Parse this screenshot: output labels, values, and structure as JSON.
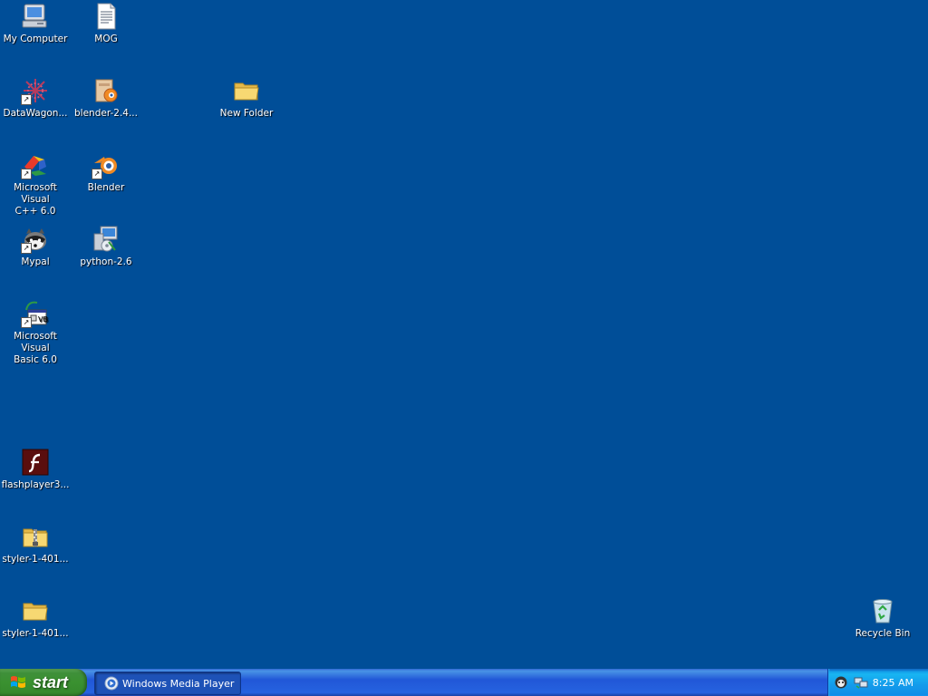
{
  "desktop": {
    "background_color": "#004E98",
    "icons": [
      {
        "label": "My Computer",
        "icon": "my-computer-icon"
      },
      {
        "label": "MOG",
        "icon": "text-document-icon"
      },
      {
        "label": "DataWagon...",
        "icon": "datawagon-icon"
      },
      {
        "label": "blender-2.4...",
        "icon": "installer-package-icon"
      },
      {
        "label": "New Folder",
        "icon": "folder-icon"
      },
      {
        "label": "Microsoft Visual\nC++ 6.0",
        "icon": "visual-cpp-icon"
      },
      {
        "label": "Blender",
        "icon": "blender-icon"
      },
      {
        "label": "Mypal",
        "icon": "mypal-icon"
      },
      {
        "label": "python-2.6",
        "icon": "python-installer-icon"
      },
      {
        "label": "Microsoft Visual\nBasic 6.0",
        "icon": "visual-basic-icon"
      },
      {
        "label": "flashplayer3...",
        "icon": "flash-player-icon"
      },
      {
        "label": "styler-1-401...",
        "icon": "zip-folder-icon"
      },
      {
        "label": "styler-1-401...",
        "icon": "folder-icon"
      },
      {
        "label": "Recycle Bin",
        "icon": "recycle-bin-icon"
      }
    ]
  },
  "taskbar": {
    "start_label": "start",
    "tasks": [
      {
        "label": "Windows Media Player",
        "icon": "windows-media-player-icon"
      }
    ],
    "tray": {
      "icons": [
        "mypal-tray-icon",
        "network-tray-icon"
      ],
      "clock": "8:25 AM"
    }
  }
}
